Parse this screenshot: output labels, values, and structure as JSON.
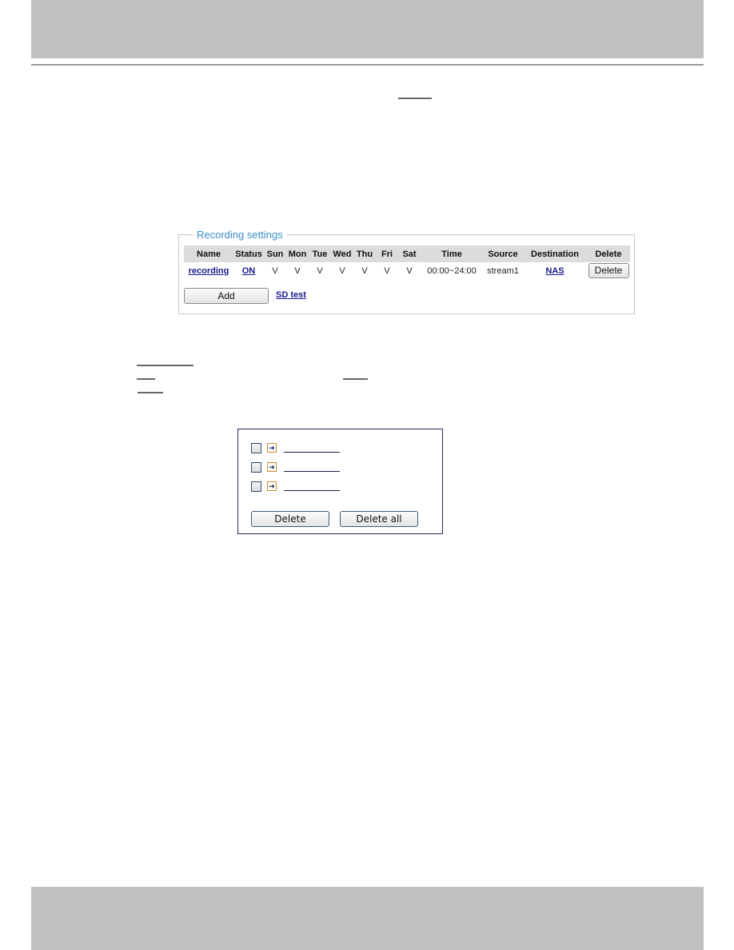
{
  "recording_settings": {
    "legend": "Recording settings",
    "columns": [
      "Name",
      "Status",
      "Sun",
      "Mon",
      "Tue",
      "Wed",
      "Thu",
      "Fri",
      "Sat",
      "Time",
      "Source",
      "Destination",
      "Delete"
    ],
    "rows": [
      {
        "name": "recording",
        "status": "ON",
        "sun": "V",
        "mon": "V",
        "tue": "V",
        "wed": "V",
        "thu": "V",
        "fri": "V",
        "sat": "V",
        "time": "00:00~24:00",
        "source": "stream1",
        "destination": "NAS",
        "delete_label": "Delete"
      }
    ],
    "add_label": "Add",
    "sd_test_label": "SD test",
    "legend_color": "#3a8fc8",
    "link_color": "#1a1a8c"
  },
  "file_list": {
    "items": [
      {
        "icon": "arrow-right-icon",
        "checked": false
      },
      {
        "icon": "arrow-right-icon",
        "checked": false
      },
      {
        "icon": "arrow-right-icon",
        "checked": false
      }
    ],
    "arrow_glyph": "➔",
    "delete_label": "Delete",
    "delete_all_label": "Delete all"
  }
}
